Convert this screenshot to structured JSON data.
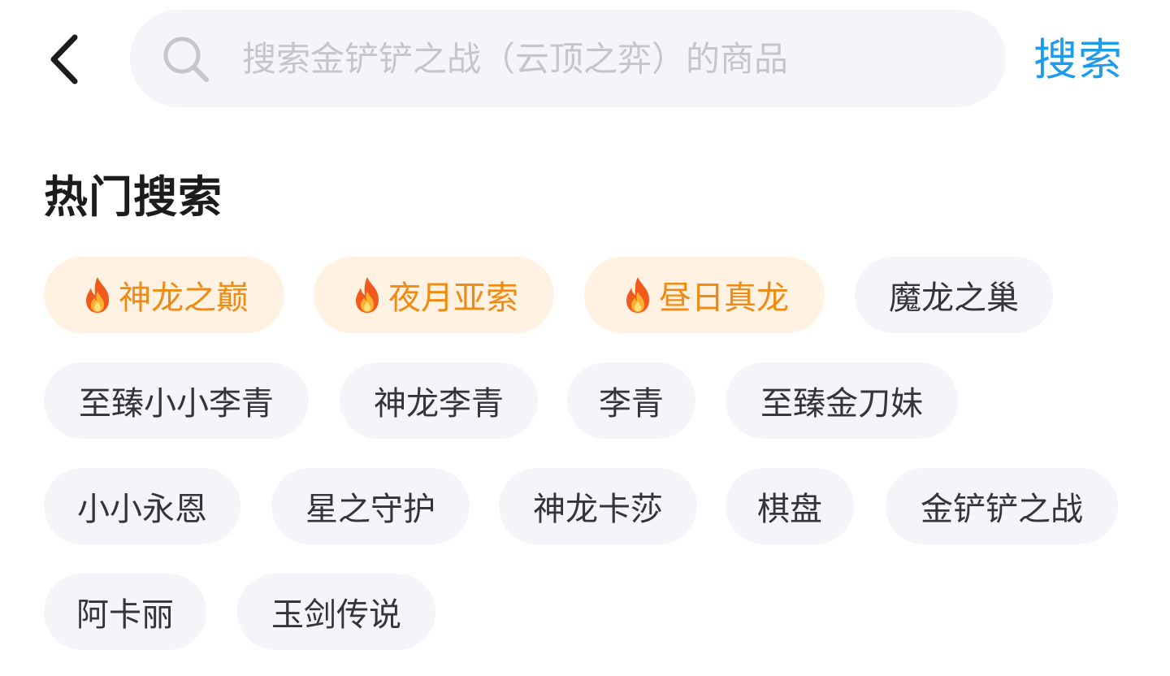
{
  "header": {
    "back_icon": "chevron-left-icon",
    "search": {
      "icon": "search-icon",
      "placeholder": "搜索金铲铲之战（云顶之弈）的商品",
      "value": ""
    },
    "search_button_label": "搜索"
  },
  "hot_search": {
    "title": "热门搜索",
    "fire_icon": "fire-icon",
    "colors": {
      "hot_text": "#f08a13",
      "hot_bg": "#fff2e2",
      "tag_bg": "#f4f5f8",
      "accent": "#1d9cec"
    },
    "tags": [
      {
        "label": "神龙之巅",
        "hot": true
      },
      {
        "label": "夜月亚索",
        "hot": true
      },
      {
        "label": "昼日真龙",
        "hot": true
      },
      {
        "label": "魔龙之巢",
        "hot": false
      },
      {
        "label": "至臻小小李青",
        "hot": false
      },
      {
        "label": "神龙李青",
        "hot": false
      },
      {
        "label": "李青",
        "hot": false
      },
      {
        "label": "至臻金刀妹",
        "hot": false
      },
      {
        "label": "小小永恩",
        "hot": false
      },
      {
        "label": "星之守护",
        "hot": false
      },
      {
        "label": "神龙卡莎",
        "hot": false
      },
      {
        "label": "棋盘",
        "hot": false
      },
      {
        "label": "金铲铲之战",
        "hot": false
      },
      {
        "label": "阿卡丽",
        "hot": false
      },
      {
        "label": "玉剑传说",
        "hot": false
      }
    ]
  }
}
